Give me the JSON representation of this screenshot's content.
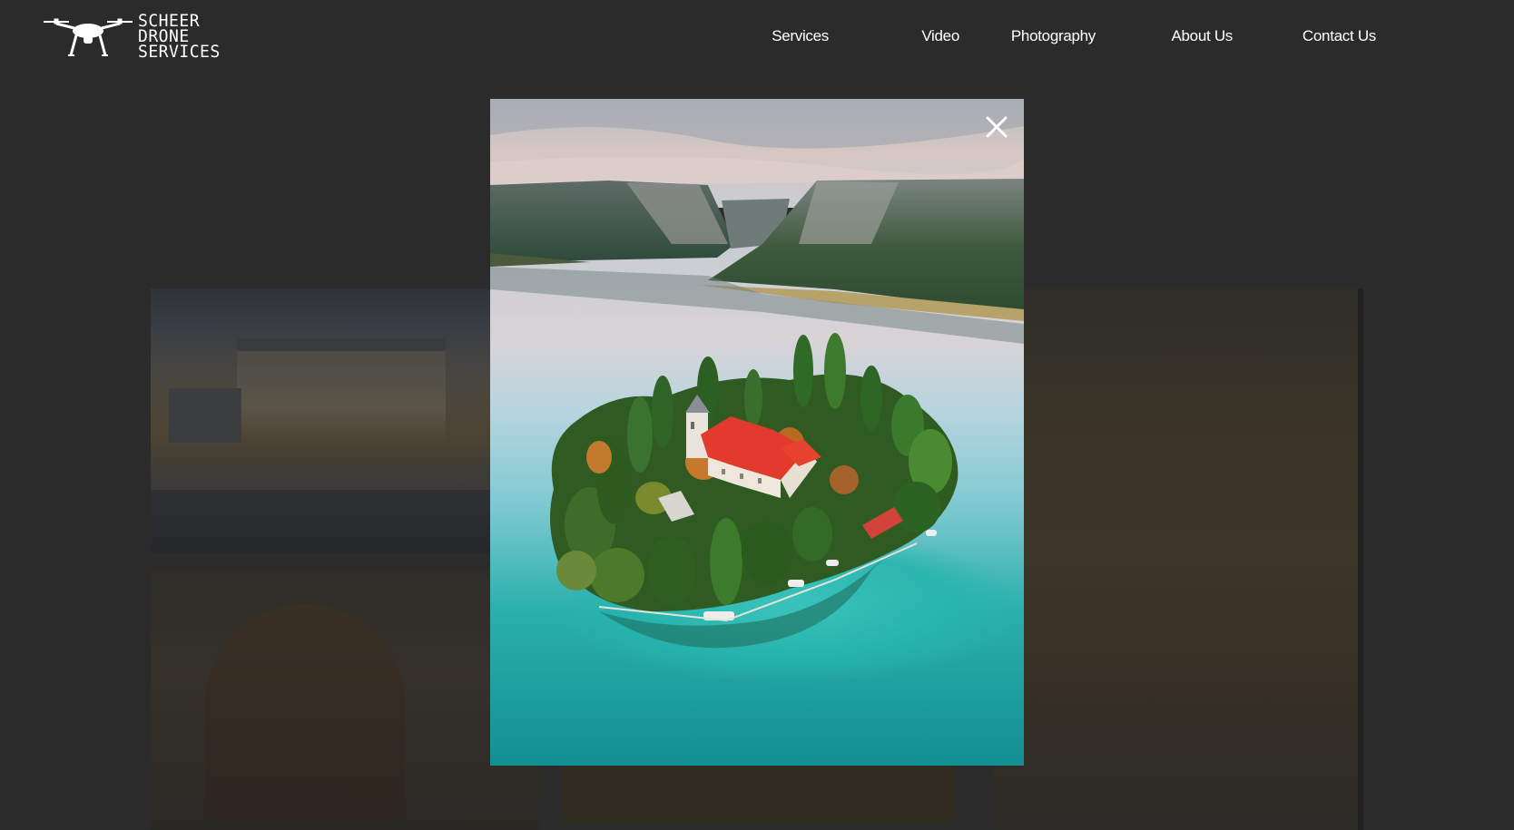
{
  "brand": {
    "line1": "SCHEER",
    "line2": "DRONE",
    "line3": "SERVICES",
    "logo_icon": "drone-icon"
  },
  "nav": {
    "items": [
      {
        "label": "Services"
      },
      {
        "label": "Video"
      },
      {
        "label": "Photography"
      },
      {
        "label": "About Us"
      },
      {
        "label": "Contact Us"
      }
    ]
  },
  "lightbox": {
    "close_icon": "close-icon",
    "image_subject": "aerial photo of an island monastery in a turquoise lake"
  },
  "colors": {
    "background": "#2b2b2b",
    "text": "#ffffff",
    "water": "#1fa3a0"
  }
}
